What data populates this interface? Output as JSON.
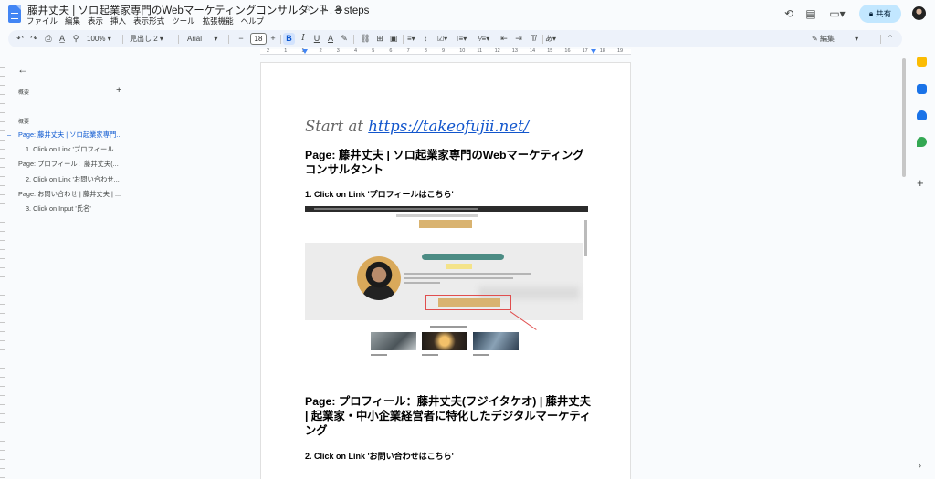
{
  "title_bar": {
    "doc_title": "藤井丈夫 | ソロ起業家専門のWebマーケティングコンサルタント, 3 steps",
    "star_icon": "star-icon",
    "move_icon": "folder-icon",
    "cloud_icon": "cloud-icon"
  },
  "menu": [
    "ファイル",
    "編集",
    "表示",
    "挿入",
    "表示形式",
    "ツール",
    "拡張機能",
    "ヘルプ"
  ],
  "top_right": {
    "history_icon": "history-icon",
    "comments_icon": "comment-icon",
    "meet_icon": "video-icon",
    "share_label": "共有",
    "share_icon": "lock-icon"
  },
  "toolbar": {
    "zoom": "100%",
    "style": "見出し 2",
    "font": "Arial",
    "font_size": "18",
    "mode": "編集",
    "bold": "B",
    "italic": "I",
    "underline": "U",
    "text_color": "A"
  },
  "ruler": {
    "numbers": [
      "2",
      "1",
      "1",
      "2",
      "3",
      "4",
      "5",
      "6",
      "7",
      "8",
      "9",
      "10",
      "11",
      "12",
      "13",
      "14",
      "15",
      "16",
      "17",
      "18",
      "19"
    ]
  },
  "outline": {
    "header": "概要",
    "section_label": "概要",
    "items": [
      {
        "label": "Page: 藤井丈夫 | ソロ起業家専門...",
        "level": 1,
        "selected": true
      },
      {
        "label": "1. Click on Link 'プロフィール...",
        "level": 2,
        "selected": false
      },
      {
        "label": "Page: プロフィール：藤井丈夫(...",
        "level": 1,
        "selected": false
      },
      {
        "label": "2. Click on Link 'お問い合わせ...",
        "level": 2,
        "selected": false
      },
      {
        "label": "Page: お問い合わせ | 藤井丈夫 | ...",
        "level": 1,
        "selected": false
      },
      {
        "label": "3. Click on Input '氏名'",
        "level": 2,
        "selected": false
      }
    ]
  },
  "document": {
    "start_prefix": "Start at ",
    "start_url": "https://takeofujii.net/",
    "page1_heading": "Page: 藤井丈夫 | ソロ起業家専門のWebマーケティングコンサルタント",
    "step1": "1. Click on Link 'プロフィールはこちら'",
    "page2_heading": "Page: プロフィール：藤井丈夫(フジイタケオ) | 藤井丈夫 | 起業家・中小企業経営者に特化したデジタルマーケティング",
    "step2": "2. Click on Link 'お問い合わせはこちら'"
  },
  "side_panel": {
    "icons": [
      "keep-icon",
      "tasks-icon",
      "contacts-icon",
      "maps-icon"
    ],
    "colors": [
      "#fbbc04",
      "#1a73e8",
      "#1a73e8",
      "#34a853"
    ]
  },
  "colors": {
    "accent": "#0b57d0",
    "share_bg": "#c2e7ff",
    "toolbar_bg": "#edf2fa",
    "link": "#1155cc",
    "highlight_box": "#e04e4e"
  }
}
